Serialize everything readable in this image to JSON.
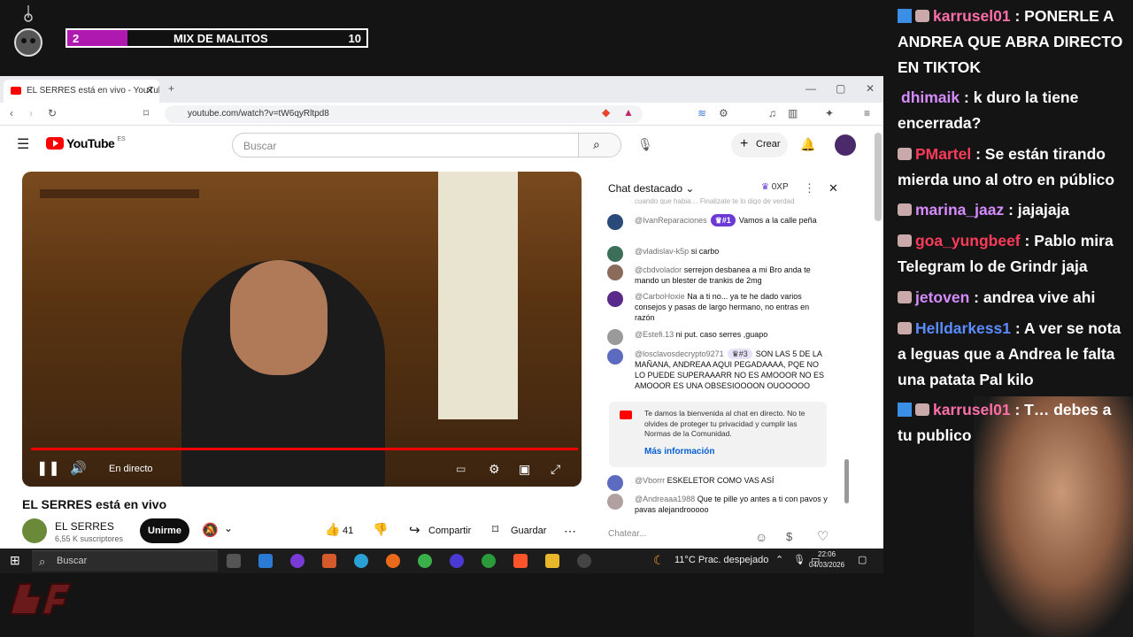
{
  "overlay": {
    "progress_start": "2",
    "progress_title": "MIX DE MALITOS",
    "progress_end": "10",
    "progress_fraction": 0.2
  },
  "browser": {
    "tab_title": "EL SERRES está en vivo - YouTube",
    "url": "youtube.com/watch?v=tW6qyRltpd8",
    "plus_icon": "+"
  },
  "youtube": {
    "logo_text": "YouTube",
    "region": "ES",
    "search_placeholder": "Buscar",
    "create_label": "Crear",
    "live_label": "En directo",
    "video_title": "EL SERRES está en vivo",
    "channel_name": "EL SERRES",
    "subscribers": "6,55 K suscriptores",
    "join_label": "Unirme",
    "likes": "41",
    "share_label": "Compartir",
    "save_label": "Guardar"
  },
  "chat": {
    "title": "Chat destacado",
    "xp": "0XP",
    "partial_top": "cuando que habia… Finalizate te lo digo de verdad",
    "messages": [
      {
        "user": "@IvanReparaciones",
        "badge": "#1",
        "text": "Vamos a la calle peña",
        "color": "#2a4a7a"
      },
      {
        "user": "@vladislav-k5p",
        "text": "si carbo",
        "color": "#3b6f5a"
      },
      {
        "user": "@cbdvolador",
        "text": "serrejon desbanea a mi Bro anda te mando un blester de trankis de 2mg",
        "color": "#8b6b5b"
      },
      {
        "user": "@CarboHoxie",
        "text": "Na a ti no... ya te he dado varios consejos y pasas de largo hermano, no entras en razón",
        "color": "#5a2a8a"
      },
      {
        "user": "@Estefi.13",
        "text": "ni put. caso serres ,guapo",
        "color": "#9a9a9a"
      },
      {
        "user": "@losclavosdecrypto9271",
        "badge": "#3",
        "text": "SON LAS 5 DE LA MAÑANA, ANDREAA AQUI PEGADAAAA, PQE NO LO PUEDE SUPERAAARR NO ES AMOOOR NO ES AMOOOR ES UNA OBSESIOOOON OUOOOOO",
        "color": "#5c6bc0"
      },
      {
        "user": "@Vborrr",
        "text": "ESKELETOR COMO VAS ASÍ",
        "color": "#5c6bc0"
      },
      {
        "user": "@Andreaaa1988",
        "text": "Que te pille yo antes a ti con pavos y pavas alejandrooooo",
        "color": "#b0a0a0"
      }
    ],
    "welcome_text": "Te damos la bienvenida al chat en directo. No te olvides de proteger tu privacidad y cumplir las Normas de la Comunidad.",
    "welcome_link": "Más información",
    "input_placeholder": "Chatear..."
  },
  "taskbar": {
    "search_label": "Buscar",
    "weather": "11°C  Prac. despejado",
    "time": "22:06",
    "date": "04/03/2026"
  },
  "stream_chat": [
    {
      "user": "karrusel01",
      "sep": ":",
      "text": "PONERLE A ANDREA QUE ABRA DIRECTO EN TIKTOK",
      "color": "#ff6fa8",
      "twitter": true
    },
    {
      "user": "dhimaik",
      "sep": ":",
      "text": "k duro la tiene encerrada?",
      "color": "#d58cff",
      "twitter": false
    },
    {
      "user": "PMartel",
      "sep": ":",
      "text": "Se están tirando mierda uno al otro en público",
      "color": "#ff3b5c",
      "twitter": false
    },
    {
      "user": "marina_jaaz",
      "sep": ":",
      "text": "jajajaja",
      "color": "#d58cff",
      "twitter": false
    },
    {
      "user": "goa_yungbeef",
      "sep": ":",
      "text": "Pablo mira Telegram lo de Grindr jaja",
      "color": "#ff3b5c",
      "twitter": false
    },
    {
      "user": "jetoven",
      "sep": ":",
      "text": "andrea vive ahi",
      "color": "#d58cff",
      "twitter": false
    },
    {
      "user": "Helldarkess1",
      "sep": ":",
      "text": "A ver se nota a leguas que a Andrea le falta una patata Pal kilo",
      "color": "#5b8cff",
      "twitter": false
    },
    {
      "user": "karrusel01",
      "sep": ":",
      "text": "T… debes a tu publico",
      "color": "#ff6fa8",
      "twitter": true
    }
  ],
  "colors": {
    "progress_fill": "#b019b0",
    "yt_red": "#ff0000",
    "badge_purple": "#6a39d6"
  }
}
